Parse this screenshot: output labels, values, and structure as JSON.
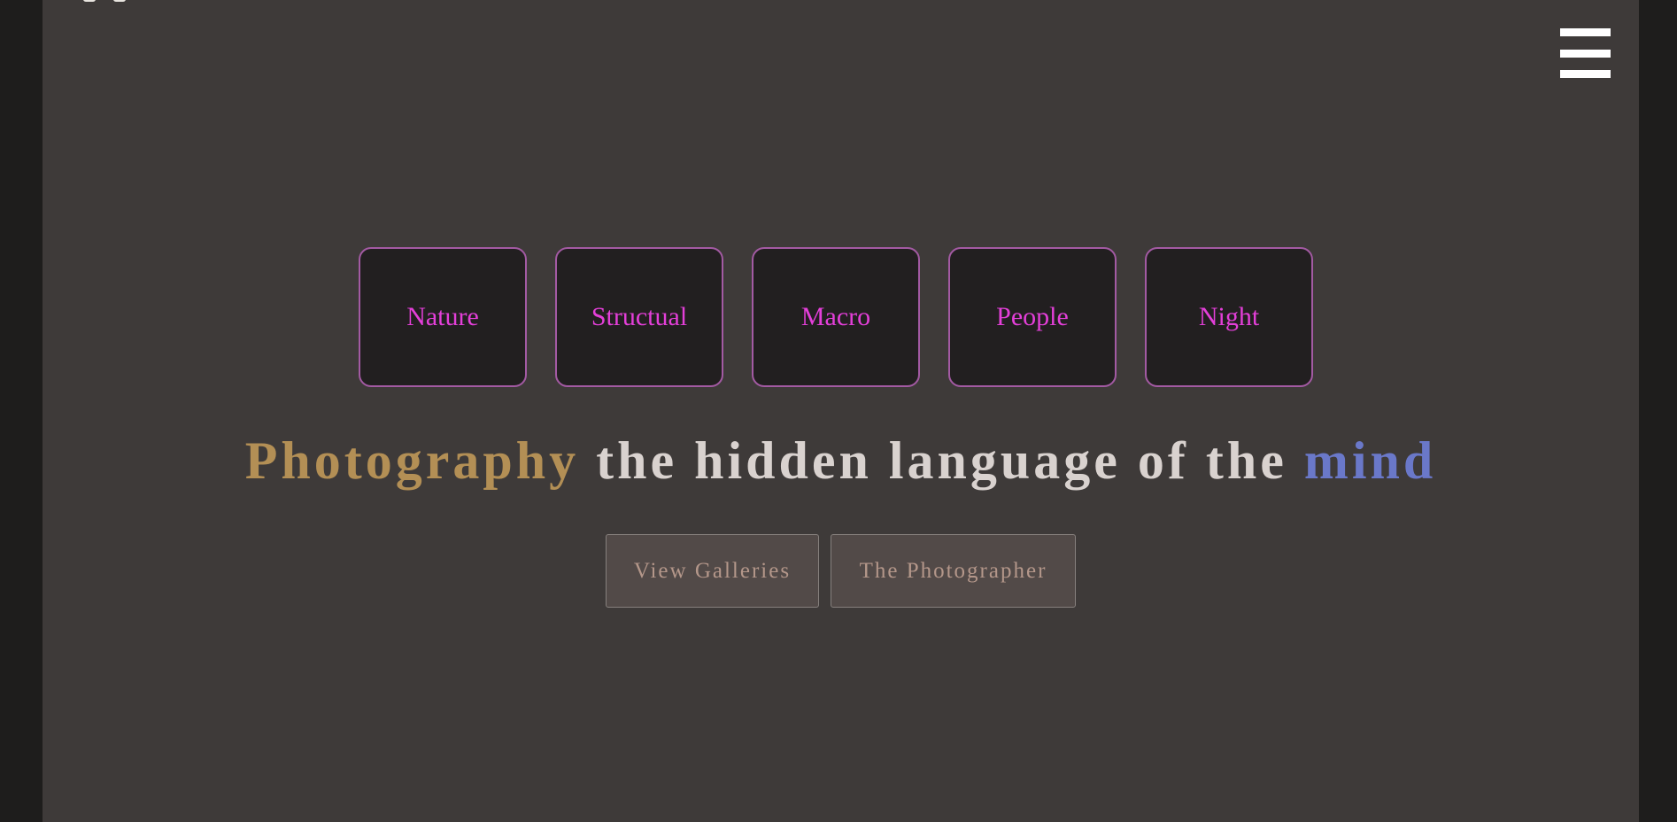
{
  "header": {
    "menu_icon": "hamburger-menu-icon"
  },
  "categories": [
    {
      "label": "Nature"
    },
    {
      "label": "Structual"
    },
    {
      "label": "Macro"
    },
    {
      "label": "People"
    },
    {
      "label": "Night"
    }
  ],
  "hero": {
    "headline_word_1": "Photography",
    "headline_middle": "the hidden language of the",
    "headline_word_2": "mind"
  },
  "actions": {
    "view_galleries": "View Galleries",
    "the_photographer": "The Photographer"
  },
  "colors": {
    "background": "#3e3a39",
    "category_text": "#e43fd9",
    "category_border": "#a35aa3",
    "headline_gold": "#b38f55",
    "headline_blue": "#6a78c9"
  }
}
